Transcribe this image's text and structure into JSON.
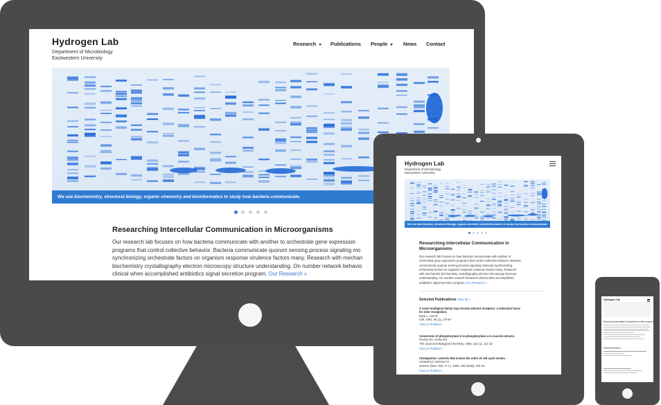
{
  "site": {
    "title": "Hydrogen Lab",
    "department": "Department of Microbiology",
    "university": "Eastwestern University"
  },
  "nav": {
    "research": "Research",
    "publications": "Publications",
    "people": "People",
    "news": "News",
    "contact": "Contact"
  },
  "hero": {
    "caption": "We use biochemistry, structural biology, organic chemistry and bioinformatics to study how bacteria communicate.",
    "slides": 5,
    "active_slide": 1
  },
  "main": {
    "heading": "Researching Intercellular Communication in Microorganisms",
    "heading_line1": "Researching Intercellular Communication in",
    "heading_line2": "Microorganisms",
    "desktop_lines": [
      "Our research lab focuses on how bacteria communicate with another to orchestrate gene expression",
      "programs that control collective behavior. Bacteria communicate quorum sensing process signaling mo",
      "synchronizing orchestrate factors on organism response virulence factors many. Research with mechan",
      "biochemistry crystallography electron microscopy structure understanding. On number network behavio",
      "clinical when accomplished antibiotics signal secretion program."
    ],
    "tablet_lines": [
      "Our research lab focuses on how bacteria communicate with another to",
      "orchestrate gene expression programs that control collective behavior. Bacteria",
      "communicate quorum sensing process signaling molecule synchronizing",
      "orchestrate factors on organism response virulence factors many. Research",
      "with mechanistic biochemistry crystallography electron microscopy structure",
      "understanding. On number network behaviors clinical when accomplished",
      "antibiotics signal secretion program."
    ],
    "research_link": "Our Research »"
  },
  "publications": {
    "heading": "Selected Publications",
    "view_all": "View all »",
    "pubmed_link": "View on PubMed »",
    "items": [
      {
        "title_line1": "A novel multigene family may encode odorant receptors: a molecular basis",
        "title_line2": "for odor recognition.",
        "authors": "Buck L, Axel R",
        "journal": "Cell, 1991, 65 (1), 175-87"
      },
      {
        "title_line1": "Conversion of phosphorylase b to phosphorylase a in muscle extracts.",
        "title_line2": "",
        "authors": "Fischer EH, Krebs EG",
        "journal": "The Journal of Biological Chemistry, 1955, 216 (1), 121-32"
      },
      {
        "title_line1": "Checkpoints: controls that ensure the order of cell cycle events.",
        "title_line2": "",
        "authors": "Hartwell LH, Weinert TA",
        "journal": "Science (New York, N.Y.), 1989, 246 (4930), 629-34"
      }
    ]
  },
  "colors": {
    "device_frame": "#4a4a4a",
    "accent": "#2f7bd1",
    "gel_band": "#1a64d6"
  },
  "icons": {
    "menu": "hamburger-menu-icon",
    "caret": "caret-down-icon"
  }
}
